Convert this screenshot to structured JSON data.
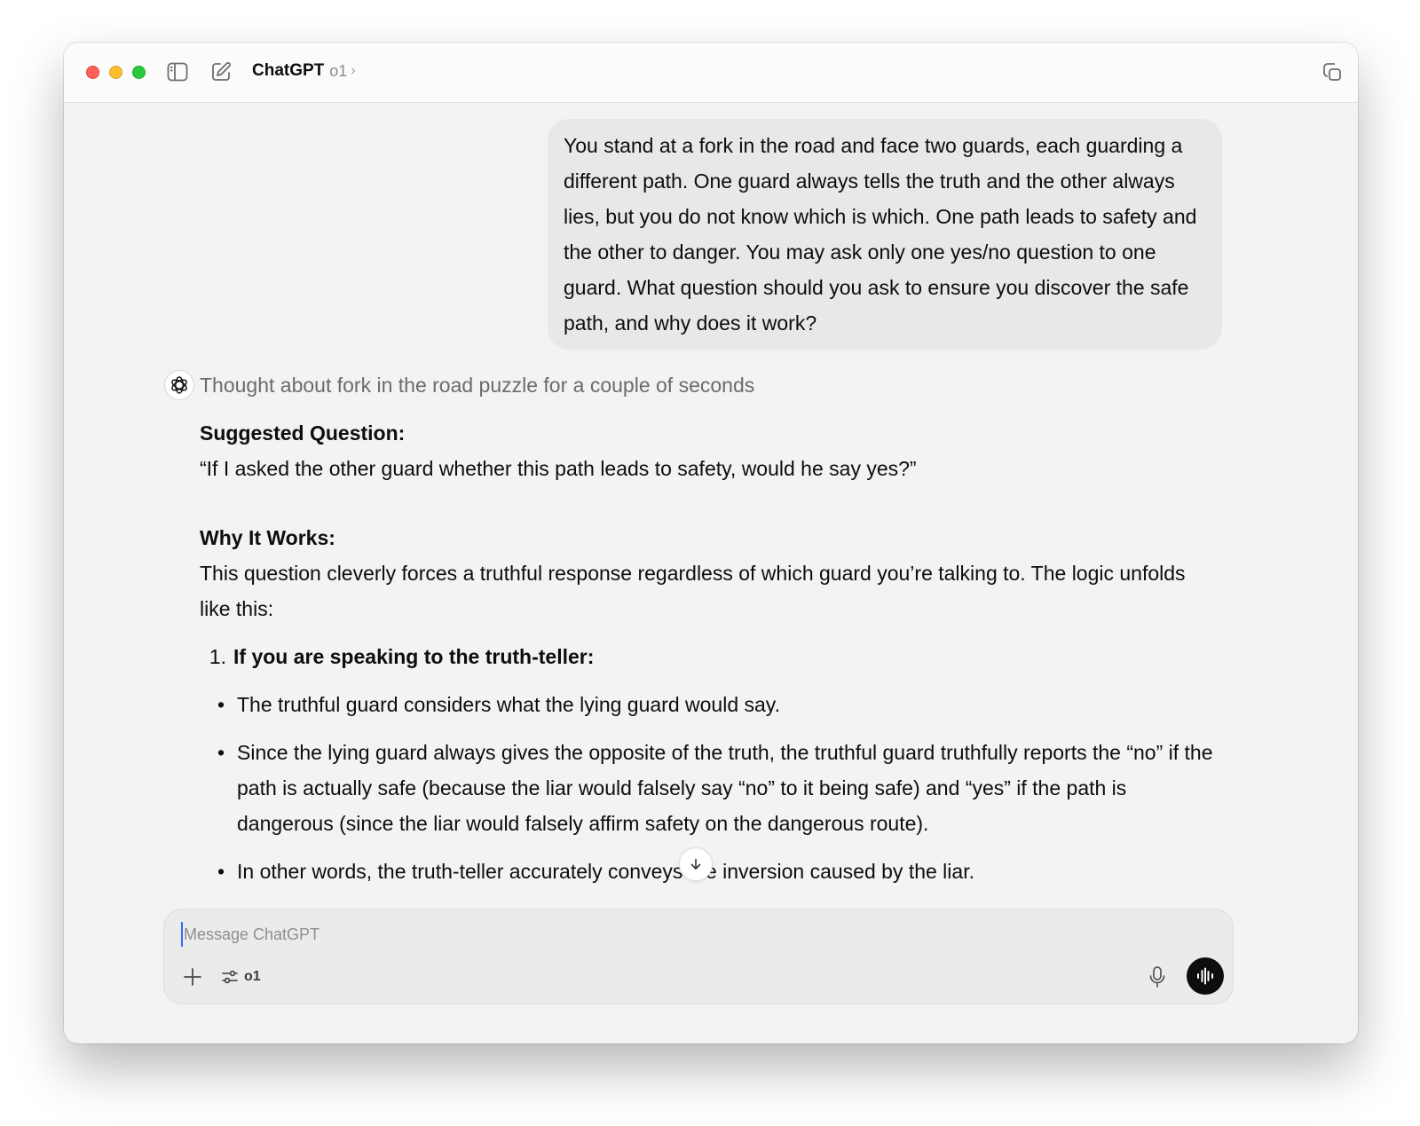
{
  "window": {
    "app_title": "ChatGPT",
    "model": "o1",
    "model_chevron": "›"
  },
  "conversation": {
    "user_message": "You stand at a fork in the road and face two guards, each guarding a different path. One guard always tells the truth and the other always lies, but you do not know which is which. One path leads to safety and the other to danger. You may ask only one yes/no question to one guard. What question should you ask to ensure you discover the safe path, and why does it work?",
    "thought_status": "Thought about fork in the road puzzle for a couple of seconds",
    "answer": {
      "heading1": "Suggested Question:",
      "question": "“If I asked the other guard whether this path leads to safety, would he say yes?”",
      "heading2": "Why It Works:",
      "intro": "This question cleverly forces a truthful response regardless of which guard you’re talking to. The logic unfolds like this:",
      "step_number": "1.",
      "step_title": "If you are speaking to the truth-teller:",
      "bullets": [
        "The truthful guard considers what the lying guard would say.",
        "Since the lying guard always gives the opposite of the truth, the truthful guard truthfully reports the “no” if the path is actually safe (because the liar would falsely say “no” to it being safe) and “yes” if the path is dangerous (since the liar would falsely affirm safety on the dangerous route).",
        "In other words, the truth-teller accurately conveys the inversion caused by the liar."
      ]
    }
  },
  "composer": {
    "placeholder": "Message ChatGPT",
    "value": "",
    "model_label": "o1"
  },
  "icons": {
    "close": "close-traffic-light",
    "minimize": "minimize-traffic-light",
    "zoom": "zoom-traffic-light",
    "sidebar": "sidebar-toggle-icon",
    "compose": "new-chat-icon",
    "copy": "window-copy-icon",
    "openai": "openai-logo-icon",
    "scroll": "arrow-down-icon",
    "plus": "plus-icon",
    "tools": "sliders-icon",
    "mic": "microphone-icon",
    "voice": "voice-waveform-icon"
  },
  "colors": {
    "close": "#fe5f57",
    "minimize": "#febc2e",
    "zoom": "#28c840",
    "user_bubble": "#e8e8e8",
    "window_bg": "#f3f3f3",
    "voice_button": "#0d0d0d"
  }
}
